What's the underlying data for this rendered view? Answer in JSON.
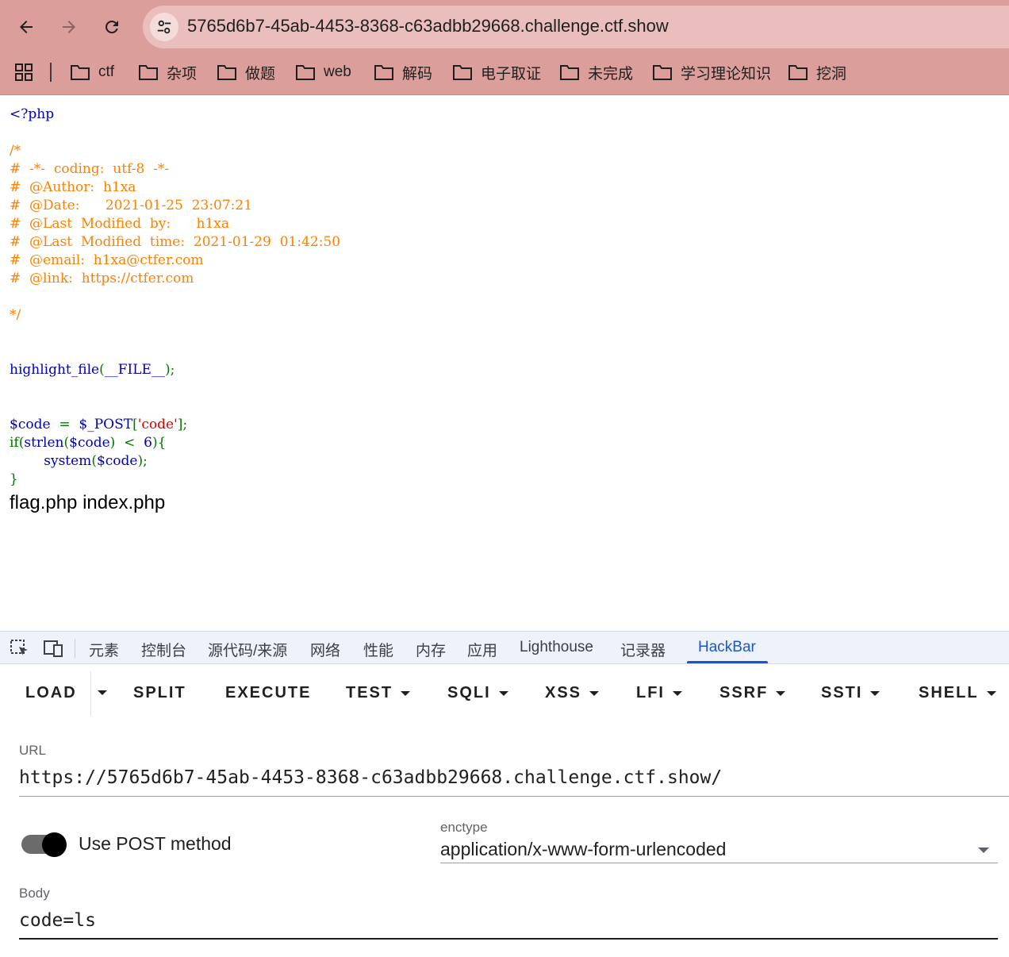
{
  "browser": {
    "url": "5765d6b7-45ab-4453-8368-c63adbb29668.challenge.ctf.show",
    "bookmarks": [
      "ctf",
      "杂项",
      "做题",
      "web",
      "解码",
      "电子取证",
      "未完成",
      "学习理论知识",
      "挖洞"
    ],
    "icons": {
      "back": "arrow-left-icon",
      "forward": "arrow-right-icon",
      "reload": "reload-icon",
      "site_info": "tune-icon",
      "apps": "apps-grid-icon",
      "folder": "folder-icon"
    }
  },
  "source": {
    "lines": [
      "<?php",
      "",
      "/*",
      "#  -*-  coding:  utf-8  -*-",
      "#  @Author:  h1xa",
      "#  @Date:      2021-01-25  23:07:21",
      "#  @Last  Modified  by:      h1xa",
      "#  @Last  Modified  time:  2021-01-29  01:42:50",
      "#  @email:  h1xa@ctfer.com",
      "#  @link:  https://ctfer.com",
      "",
      "*/",
      "",
      "",
      "highlight_file",
      "(__FILE__);",
      "",
      "",
      "$code  =  $_POST['code'];",
      "if(strlen($code)  <  6){",
      "        system($code);",
      "}"
    ],
    "tokens": {
      "php_open": "<?php",
      "comment_open": "/*",
      "comment_close": "*/",
      "highlight_fn": "highlight_file",
      "paren_open": "(",
      "file_const": "__FILE__",
      "paren_close_semi": ");",
      "code_var": "$code",
      "assign": "  =  ",
      "post_var": "$_POST",
      "bracket_open": "[",
      "code_key": "'code'",
      "bracket_close_semi": "];",
      "if_kw": "if",
      "strlen_fn": "strlen",
      "code_var2": "$code",
      "lt": ")  <  ",
      "six": "6",
      "brace_open": "){",
      "indent": "        ",
      "system_fn": "system",
      "code_var3": "$code",
      "brace_close": "}"
    },
    "output": "flag.php index.php"
  },
  "devtools": {
    "tabs": [
      "元素",
      "控制台",
      "源代码/来源",
      "网络",
      "性能",
      "内存",
      "应用",
      "Lighthouse",
      "记录器",
      "HackBar"
    ],
    "active_tab": "HackBar",
    "icons": {
      "inspect": "inspect-element-icon",
      "device": "device-toolbar-icon"
    }
  },
  "hackbar": {
    "buttons": {
      "load": "LOAD",
      "split": "SPLIT",
      "execute": "EXECUTE",
      "test": "TEST",
      "sqli": "SQLI",
      "xss": "XSS",
      "lfi": "LFI",
      "ssrf": "SSRF",
      "ssti": "SSTI",
      "shell": "SHELL"
    },
    "url_label": "URL",
    "url_value": "https://5765d6b7-45ab-4453-8368-c63adbb29668.challenge.ctf.show/",
    "post_method_label": "Use POST method",
    "post_method_enabled": true,
    "enctype_label": "enctype",
    "enctype_value": "application/x-www-form-urlencoded",
    "body_label": "Body",
    "body_value": "code=ls"
  },
  "colors": {
    "chrome": "#dc9e9b",
    "omnibox": "#e9bebc",
    "php_keyword": "#0000bb",
    "php_comment": "#ff8000",
    "php_punct": "#007700",
    "php_string": "#dd0000",
    "devtools_accent": "#1a56c9"
  }
}
